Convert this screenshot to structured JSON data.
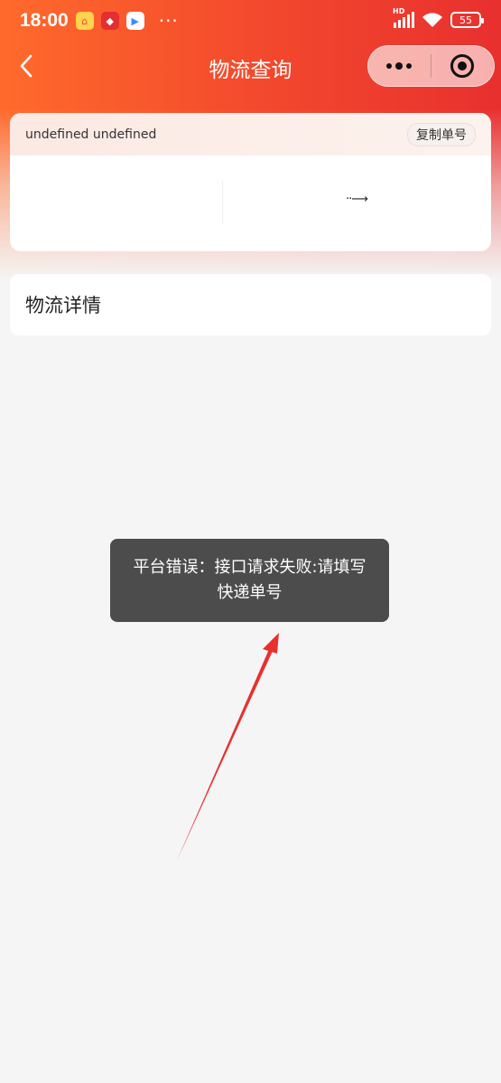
{
  "status_bar": {
    "time": "18:00",
    "more": "···",
    "network_label": "HD",
    "battery": "55"
  },
  "nav": {
    "title": "物流查询"
  },
  "tracking": {
    "number": "undefined undefined",
    "copy_label": "复制单号"
  },
  "detail": {
    "title": "物流详情"
  },
  "toast": {
    "message": "平台错误：接口请求失败:请填写快递单号"
  },
  "colors": {
    "header_start": "#ff6a2c",
    "header_end": "#e8302f",
    "toast_bg": "#4c4c4c",
    "annotation_arrow": "#e8302f"
  }
}
